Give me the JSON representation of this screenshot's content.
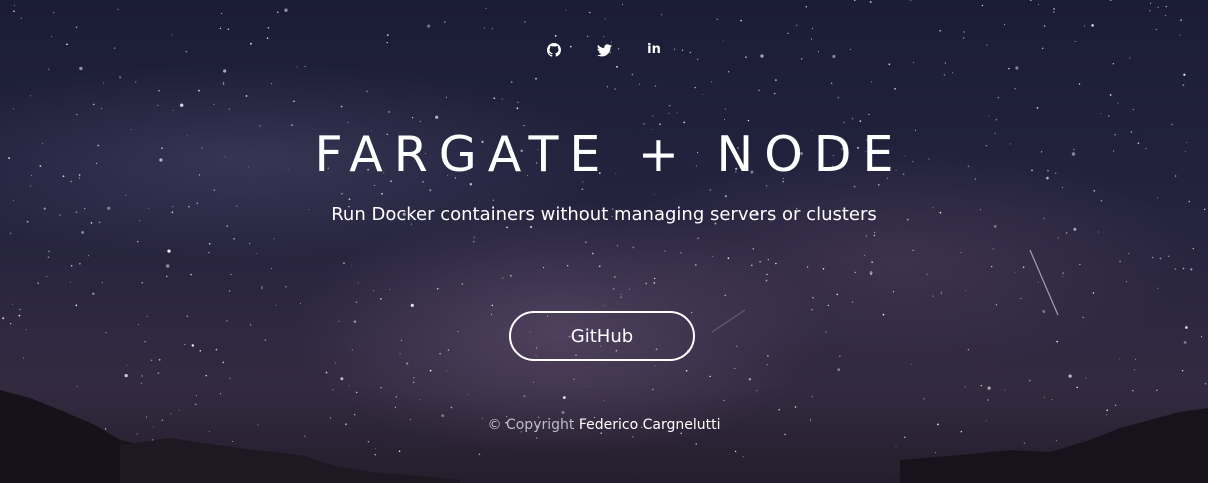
{
  "social": {
    "items": [
      {
        "icon": "github-icon",
        "label": "GitHub"
      },
      {
        "icon": "twitter-icon",
        "label": "Twitter"
      },
      {
        "icon": "linkedin-icon",
        "label": "in"
      }
    ]
  },
  "hero": {
    "title": "FARGATE + NODE",
    "subtitle": "Run Docker containers without managing servers or clusters",
    "cta_label": "GitHub"
  },
  "footer": {
    "copyright_prefix": "© Copyright",
    "author": "Federico Cargnelutti"
  },
  "colors": {
    "sky_top": "#1b1c35",
    "sky_bottom": "#241e2c",
    "text": "#ffffff",
    "muted_text": "#bdbdc8"
  }
}
